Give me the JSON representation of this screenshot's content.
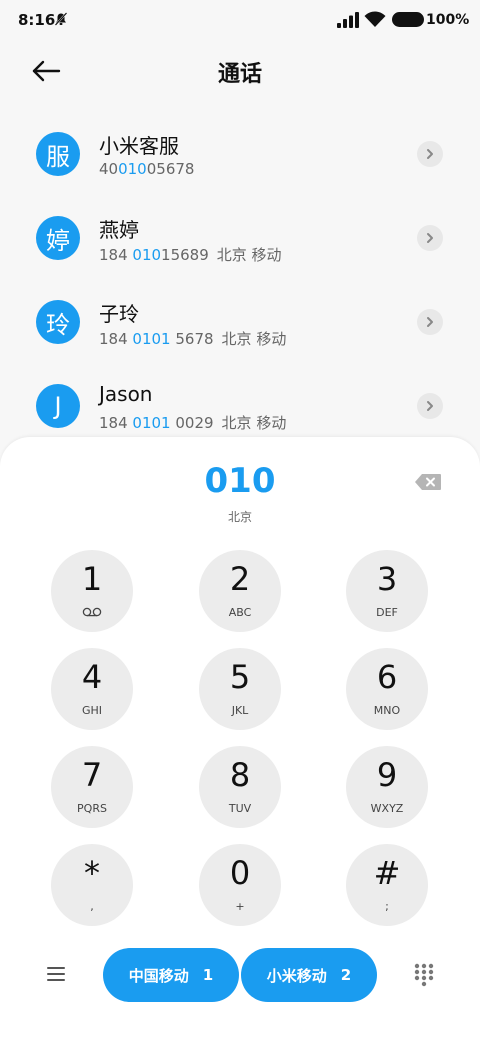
{
  "status": {
    "time": "8:16",
    "battery": "100%"
  },
  "header": {
    "title": "通话"
  },
  "contacts": [
    {
      "avatar": "服",
      "name": "小米客服",
      "num_pre": "40",
      "num_hl": "010",
      "num_post": "05678",
      "location": ""
    },
    {
      "avatar": "婷",
      "name": "燕婷",
      "num_pre": "184 ",
      "num_hl": "010",
      "num_post": "15689",
      "location": "北京 移动"
    },
    {
      "avatar": "玲",
      "name": "子玲",
      "num_pre": "184 ",
      "num_hl": "0101",
      "num_post": " 5678",
      "location": "北京 移动"
    },
    {
      "avatar": "J",
      "name": "Jason",
      "num_pre": "184 ",
      "num_hl": "0101",
      "num_post": " 0029",
      "location": "北京 移动"
    }
  ],
  "dialer": {
    "number": "010",
    "location": "北京",
    "keys": [
      {
        "digit": "1",
        "sub": ""
      },
      {
        "digit": "2",
        "sub": "ABC"
      },
      {
        "digit": "3",
        "sub": "DEF"
      },
      {
        "digit": "4",
        "sub": "GHI"
      },
      {
        "digit": "5",
        "sub": "JKL"
      },
      {
        "digit": "6",
        "sub": "MNO"
      },
      {
        "digit": "7",
        "sub": "PQRS"
      },
      {
        "digit": "8",
        "sub": "TUV"
      },
      {
        "digit": "9",
        "sub": "WXYZ"
      },
      {
        "digit": "*",
        "sub": ","
      },
      {
        "digit": "0",
        "sub": "+"
      },
      {
        "digit": "#",
        "sub": ";"
      }
    ],
    "sim1": {
      "label": "中国移动",
      "num": "1"
    },
    "sim2": {
      "label": "小米移动",
      "num": "2"
    }
  },
  "icons": {
    "bell": "bell-muted-icon",
    "signal": "signal-icon",
    "wifi": "wifi-icon",
    "battery": "battery-icon",
    "back": "back-arrow-icon",
    "detail": "chevron-right-icon",
    "backspace": "backspace-icon",
    "voicemail": "voicemail-icon",
    "menu": "menu-icon",
    "keypad": "keypad-icon"
  },
  "colors": {
    "accent": "#1a9cf0",
    "key_bg": "#ececec",
    "page_bg": "#f7f7f7"
  }
}
